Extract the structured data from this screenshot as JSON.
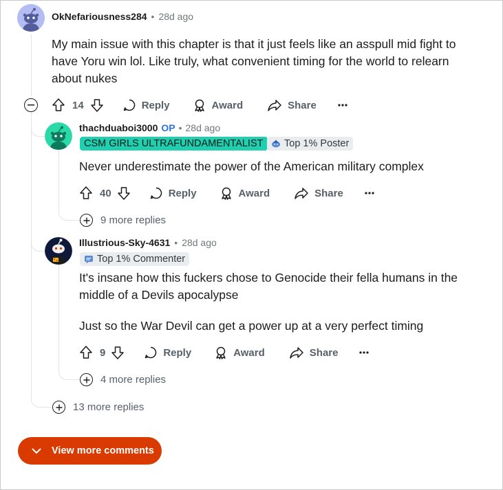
{
  "comments": [
    {
      "username": "OkNefariousness284",
      "time": "28d ago",
      "body_lines": [
        "My main issue with this chapter is that it just feels like an asspull mid fight to",
        "have Yoru win lol. Like truly, what convenient timing for the world to relearn",
        "about nukes"
      ],
      "votes": "14",
      "reply_label": "Reply",
      "award_label": "Award",
      "share_label": "Share",
      "more_replies": "13 more replies"
    },
    {
      "username": "thachduaboi3000",
      "op_label": "OP",
      "time": "28d ago",
      "flair": "CSM GIRLS ULTRAFUNDAMENTALIST",
      "badge": "Top 1% Poster",
      "body_lines": [
        "Never underestimate the power of the American military complex"
      ],
      "votes": "40",
      "reply_label": "Reply",
      "award_label": "Award",
      "share_label": "Share",
      "more_replies": "9 more replies"
    },
    {
      "username": "Illustrious-Sky-4631",
      "time": "28d ago",
      "badge": "Top 1% Commenter",
      "body_lines": [
        "It's insane how this fuckers chose to Genocide their fella humans in the",
        "middle of a Devils apocalypse",
        "",
        "Just so the War Devil can get a power up at a very perfect timing"
      ],
      "votes": "9",
      "reply_label": "Reply",
      "award_label": "Award",
      "share_label": "Share",
      "more_replies": "4 more replies"
    }
  ],
  "dot_separator": "•",
  "view_more": "View more comments",
  "colors": {
    "flair_bg": "#1fcfb0",
    "badge_bg": "#eaedef",
    "button_bg": "#d93a00",
    "op": "#2b73d8"
  },
  "icons": [
    "reddit-avatar-icon",
    "collapse-icon",
    "upvote-icon",
    "downvote-icon",
    "comment-icon",
    "award-icon",
    "share-icon",
    "more-icon",
    "expand-plus-icon",
    "chevron-down-icon"
  ]
}
